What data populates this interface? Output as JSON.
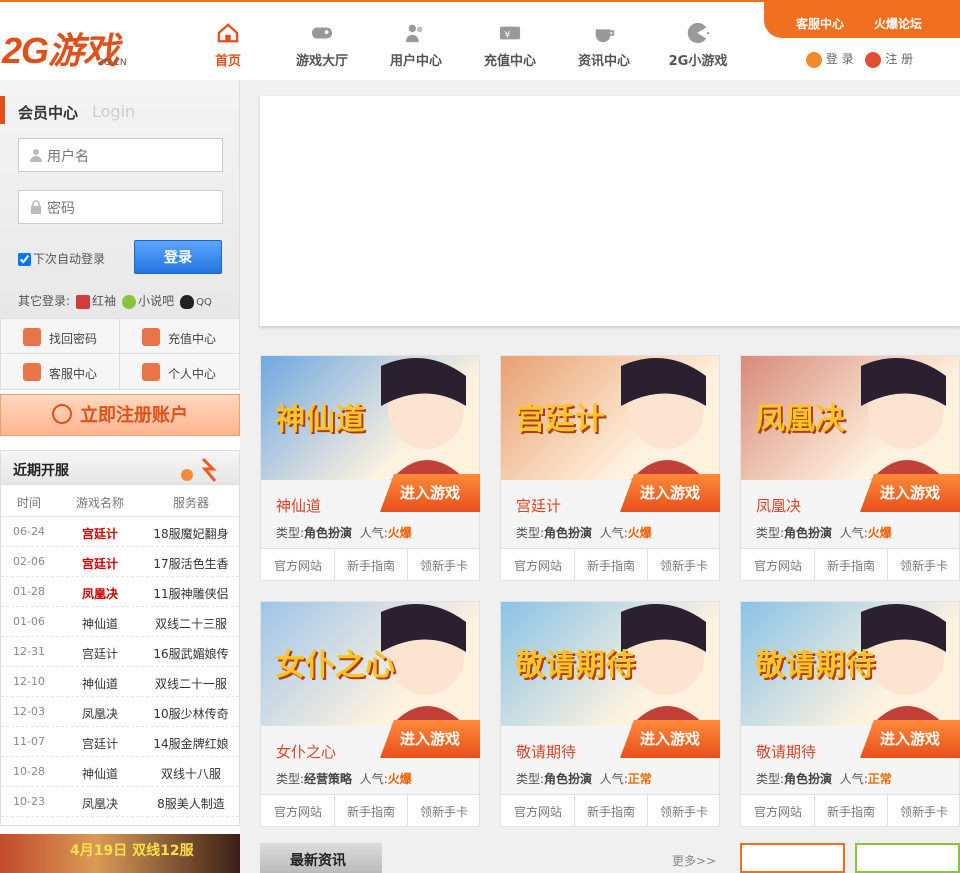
{
  "header": {
    "logo_text": "2G游戏",
    "logo_domain": "2G.CN",
    "nav": [
      {
        "label": "首页",
        "icon": "home-icon"
      },
      {
        "label": "游戏大厅",
        "icon": "gamepad-icon"
      },
      {
        "label": "用户中心",
        "icon": "users-icon"
      },
      {
        "label": "充值中心",
        "icon": "card-icon"
      },
      {
        "label": "资讯中心",
        "icon": "cup-icon"
      },
      {
        "label": "2G小游戏",
        "icon": "pacman-icon"
      }
    ],
    "top_links": [
      "客服中心",
      "火爆论坛"
    ],
    "login_link": "登 录",
    "register_link": "注 册"
  },
  "member": {
    "title": "会员中心",
    "subtitle": "Login",
    "username_placeholder": "用户名",
    "password_placeholder": "密码",
    "auto_login": "下次自动登录",
    "login_button": "登录",
    "other_login_label": "其它登录:",
    "other_login": [
      "红袖",
      "小说吧",
      "QQ"
    ]
  },
  "quick_links": [
    "找回密码",
    "充值中心",
    "客服中心",
    "个人中心"
  ],
  "register_button": "立即注册账户",
  "recent_servers": {
    "title": "近期开服",
    "headers": [
      "时间",
      "游戏名称",
      "服务器"
    ],
    "rows": [
      {
        "date": "06-24",
        "game": "宫廷计",
        "server": "18服魔妃翻身",
        "hot": true
      },
      {
        "date": "02-06",
        "game": "宫廷计",
        "server": "17服活色生香",
        "hot": true
      },
      {
        "date": "01-28",
        "game": "凤凰决",
        "server": "11服神雕侠侣",
        "hot": true
      },
      {
        "date": "01-06",
        "game": "神仙道",
        "server": "双线二十三服",
        "hot": false
      },
      {
        "date": "12-31",
        "game": "宫廷计",
        "server": "16服武媚娘传",
        "hot": false
      },
      {
        "date": "12-10",
        "game": "神仙道",
        "server": "双线二十一服",
        "hot": false
      },
      {
        "date": "12-03",
        "game": "凤凰决",
        "server": "10服少林传奇",
        "hot": false
      },
      {
        "date": "11-07",
        "game": "宫廷计",
        "server": "14服金牌红娘",
        "hot": false
      },
      {
        "date": "10-28",
        "game": "神仙道",
        "server": "双线十八服",
        "hot": false
      },
      {
        "date": "10-23",
        "game": "凤凰决",
        "server": "8服美人制造",
        "hot": false
      }
    ]
  },
  "bottom_ad": "4月19日 双线12服",
  "games": [
    {
      "name": "神仙道",
      "art_text": "神仙道",
      "type": "角色扮演",
      "popularity": "火爆",
      "color": "#6fa8e0"
    },
    {
      "name": "宫廷计",
      "art_text": "宫廷计",
      "type": "角色扮演",
      "popularity": "火爆",
      "color": "#e9a070"
    },
    {
      "name": "凤凰决",
      "art_text": "凤凰决",
      "type": "角色扮演",
      "popularity": "火爆",
      "color": "#d88a7a"
    },
    {
      "name": "女仆之心",
      "art_text": "女仆之心",
      "type": "经营策略",
      "popularity": "火爆",
      "color": "#9fc4e8"
    },
    {
      "name": "敬请期待",
      "art_text": "敬请期待",
      "type": "角色扮演",
      "popularity": "正常",
      "color": "#89c3e6"
    },
    {
      "name": "敬请期待",
      "art_text": "敬请期待",
      "type": "角色扮演",
      "popularity": "正常",
      "color": "#89c3e6"
    }
  ],
  "card_labels": {
    "enter": "进入游戏",
    "type_label": "类型:",
    "pop_label": "人气:",
    "links": [
      "官方网站",
      "新手指南",
      "领新手卡"
    ]
  },
  "news": {
    "title": "最新资讯",
    "more": "更多>>"
  }
}
